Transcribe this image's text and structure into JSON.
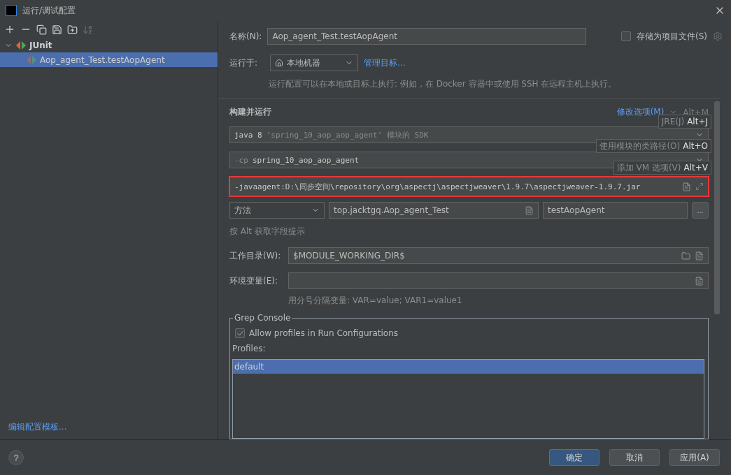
{
  "window": {
    "title": "运行/调试配置"
  },
  "tree": [
    {
      "label": "JUnit",
      "expanded": true,
      "selected": false,
      "children": [
        {
          "label": "Aop_agent_Test.testAopAgent",
          "selected": true
        }
      ]
    }
  ],
  "edit_templates_link": "编辑配置模板...",
  "name_row": {
    "label": "名称(N):",
    "value": "Aop_agent_Test.testAopAgent",
    "store_label": "存储为项目文件(S)",
    "store_checked": false
  },
  "run_on": {
    "label": "运行于:",
    "value": "本地机器",
    "link": "管理目标...",
    "hint": "运行配置可以在本地或目标上执行: 例如，在 Docker 容器中或使用 SSH 在远程主机上执行。"
  },
  "build_run": {
    "title": "构建并运行",
    "modify_link": "修改选项(M)",
    "modify_shortcut": "Alt+M",
    "jdk": {
      "version": "java 8",
      "description": "'spring_10_aop_aop_agent' 模块的 SDK"
    },
    "classpath": {
      "flag": "-cp",
      "module": "spring_10_aop_aop_agent"
    },
    "vm_options": {
      "value": "-javaagent:D:\\同步空间\\repository\\org\\aspectj\\aspectjweaver\\1.9.7\\aspectjweaver-1.9.7.jar",
      "highlighted": true
    },
    "test_kind": "方法",
    "test_class": "top.jacktgq.Aop_agent_Test",
    "test_method": "testAopAgent",
    "more_button": "...",
    "alt_hint": "按 Alt 获取字段提示"
  },
  "hints": [
    {
      "label": "JRE(J)",
      "shortcut": "Alt+J"
    },
    {
      "label": "使用模块的类路径(O)",
      "shortcut": "Alt+O"
    },
    {
      "label": "添加 VM 选项(V)",
      "shortcut": "Alt+V"
    }
  ],
  "working_dir": {
    "label": "工作目录(W):",
    "value": "$MODULE_WORKING_DIR$"
  },
  "env_vars": {
    "label": "环境变量(E):",
    "hint": "用分号分隔变量: VAR=value; VAR1=value1"
  },
  "grep_console": {
    "title": "Grep Console",
    "allow_label": "Allow profiles in Run Configurations",
    "allow_checked": true,
    "profiles_label": "Profiles:",
    "profiles": [
      {
        "label": "default",
        "selected": true
      }
    ]
  },
  "help_button": "?",
  "buttons": [
    {
      "label": "确定",
      "primary": true
    },
    {
      "label": "取消",
      "primary": false
    },
    {
      "label": "应用(A)",
      "primary": false
    }
  ]
}
